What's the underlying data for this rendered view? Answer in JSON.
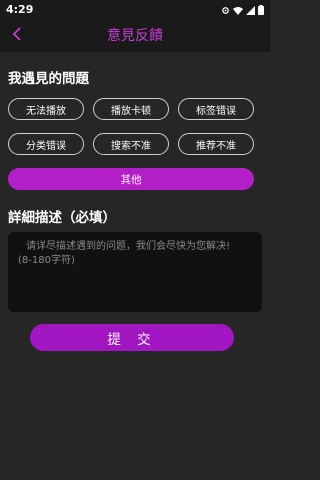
{
  "status_bar": {
    "time": "4:29",
    "icons": [
      "settings-icon",
      "wifi-icon",
      "signal-icon",
      "battery-icon"
    ]
  },
  "app_bar": {
    "title": "意見反饋",
    "back_icon": "chevron-left-icon",
    "title_color": "#c93ad6"
  },
  "problems_section": {
    "title": "我遇見的問題",
    "chips": [
      {
        "label": "无法播放"
      },
      {
        "label": "播放卡顿"
      },
      {
        "label": "标签错误"
      },
      {
        "label": "分类错误"
      },
      {
        "label": "搜索不准"
      },
      {
        "label": "推荐不准"
      }
    ],
    "other_label": "其他"
  },
  "details_section": {
    "title": "詳細描述（必填）",
    "placeholder_line1": "请详尽描述遇到的问题，我们会尽快为您解决!",
    "placeholder_line2": "(8-180字符)"
  },
  "submit_label": "提 交",
  "colors": {
    "accent": "#b31fc7",
    "background": "#262626",
    "bar": "#1a1a1a"
  }
}
